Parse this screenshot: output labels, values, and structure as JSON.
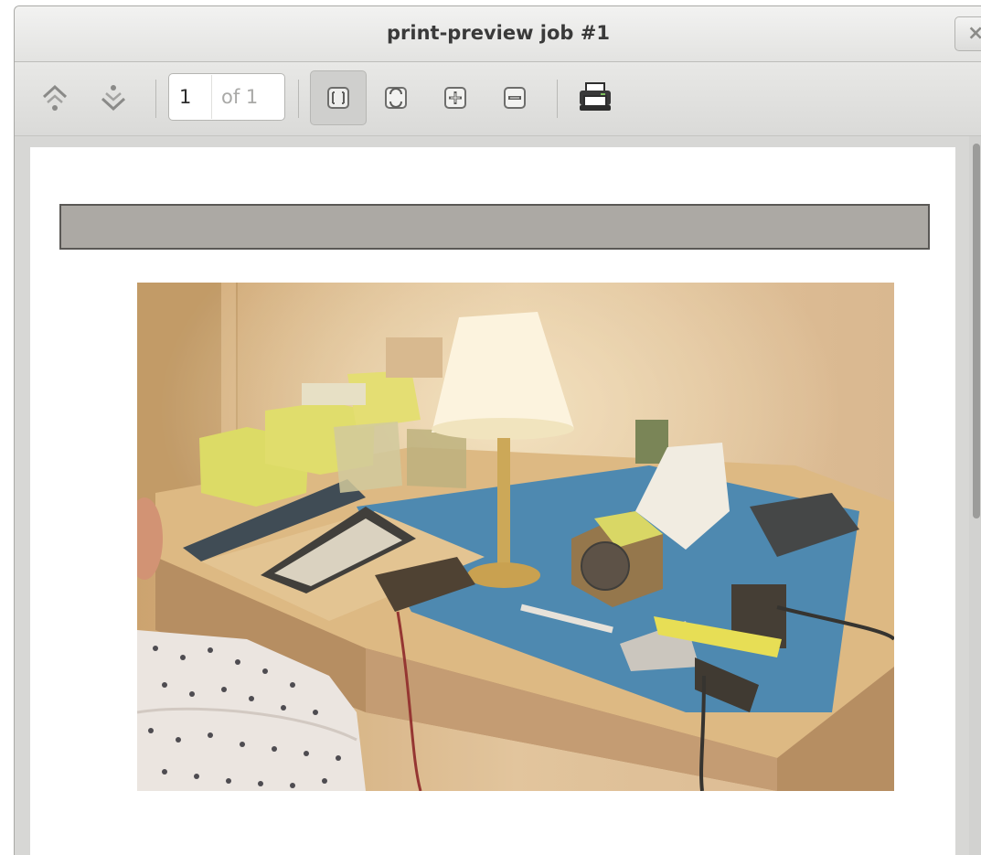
{
  "window": {
    "title": "print-preview job #1",
    "close_label": "×"
  },
  "toolbar": {
    "prev_page_icon": "page-up-icon",
    "next_page_icon": "page-down-icon",
    "current_page": "1",
    "page_total": "of 1",
    "fit_page_icon": "fit-page-icon",
    "fit_width_icon": "fit-width-icon",
    "zoom_in_icon": "zoom-in-icon",
    "zoom_out_icon": "zoom-out-icon",
    "print_icon": "printer-icon"
  },
  "document": {
    "header_bar_color": "#aca9a4",
    "photo_description_icon": "workbench-photo"
  }
}
